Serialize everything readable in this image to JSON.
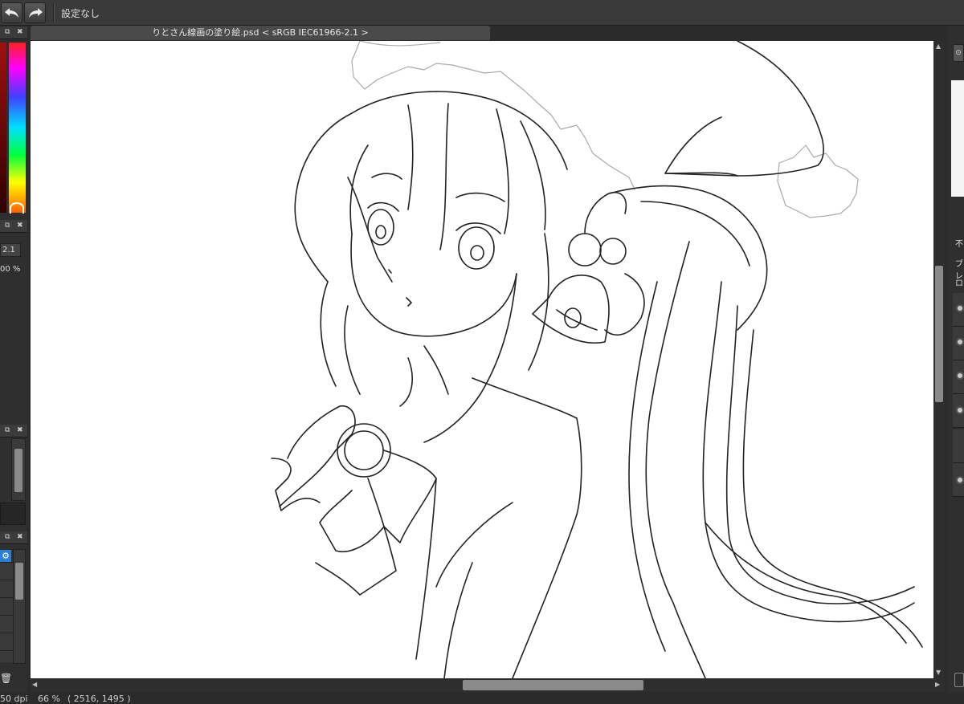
{
  "toolbar": {
    "undo_icon": "undo-icon",
    "redo_icon": "redo-icon",
    "preset_label": "設定なし"
  },
  "document": {
    "tab_title": "りとさん線画の塗り絵.psd < sRGB IEC61966-2.1 >"
  },
  "left_panel": {
    "color_field_value": "2.1",
    "percent_value": "00 %"
  },
  "status": {
    "dpi": "50 dpi",
    "zoom": "66 %",
    "coords": "( 2516, 1495 )"
  },
  "right_panel": {
    "label1": "不",
    "label2": "ブレ",
    "label3": "ロ"
  },
  "colors": {
    "app_bg": "#2b2b2b",
    "canvas": "#ffffff",
    "accent": "#2b7fd0"
  }
}
